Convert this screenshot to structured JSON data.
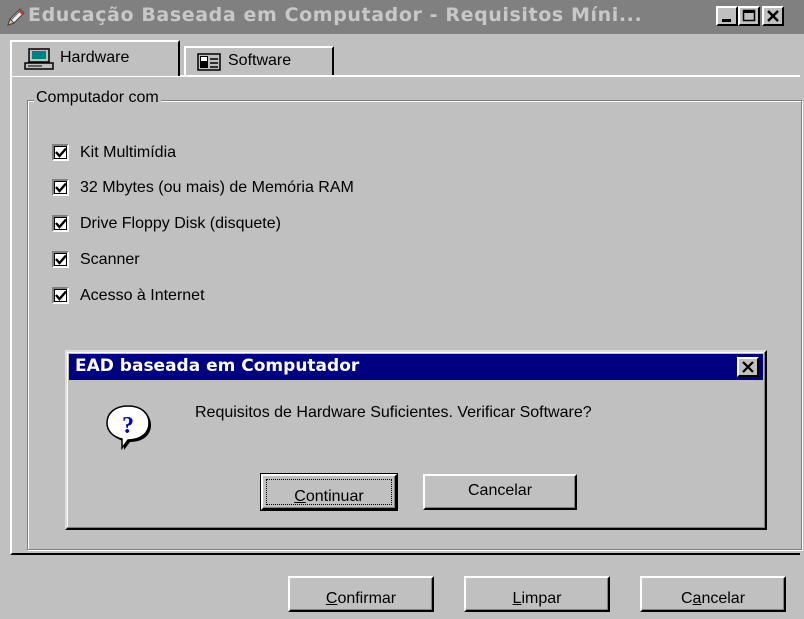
{
  "window": {
    "title": "Educação Baseada em Computador - Requisitos Míni...",
    "icon": "pencil-icon",
    "controls": [
      "minimize-icon",
      "maximize-icon",
      "close-icon"
    ]
  },
  "tabs": [
    {
      "label": "Hardware",
      "icon": "computer-icon",
      "selected": true
    },
    {
      "label": "Software",
      "icon": "disk-drive-icon",
      "selected": false
    }
  ],
  "group": {
    "legend": "Computador com",
    "items": [
      {
        "label": "Kit Multimídia",
        "checked": true
      },
      {
        "label": "32 Mbytes (ou mais) de Memória RAM",
        "checked": true
      },
      {
        "label": "Drive Floppy Disk (disquete)",
        "checked": true
      },
      {
        "label": "Scanner",
        "checked": true
      },
      {
        "label": "Acesso à Internet",
        "checked": true
      }
    ]
  },
  "dialog": {
    "title": "EAD baseada em Computador",
    "icon": "question-icon",
    "message": "Requisitos de Hardware Suficientes. Verificar Software?",
    "buttons": {
      "continue": {
        "pre": "",
        "mnemonic": "C",
        "post": "ontinuar"
      },
      "cancel": {
        "label": "Cancelar"
      }
    }
  },
  "footer": {
    "confirm": {
      "pre": "",
      "mnemonic": "C",
      "post": "onfirmar"
    },
    "clear": {
      "pre": "",
      "mnemonic": "L",
      "post": "impar"
    },
    "cancel": {
      "pre": "C",
      "mnemonic": "a",
      "post": "ncelar"
    }
  },
  "colors": {
    "face": "#c0c0c0",
    "inactive_title": "#808080",
    "active_title": "#000080"
  }
}
